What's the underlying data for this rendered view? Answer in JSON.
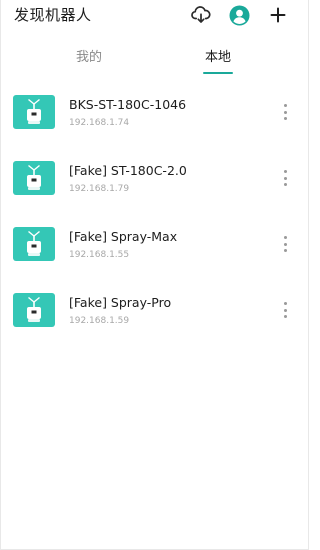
{
  "header": {
    "title": "发现机器人",
    "icons": [
      "cloud-download-icon",
      "user-avatar-icon",
      "add-icon"
    ]
  },
  "tabs": [
    {
      "label": "我的",
      "active": false
    },
    {
      "label": "本地",
      "active": true
    }
  ],
  "devices": [
    {
      "name": "BKS-ST-180C-1046",
      "ip": "192.168.1.74"
    },
    {
      "name": "[Fake] ST-180C-2.0",
      "ip": "192.168.1.79"
    },
    {
      "name": "[Fake] Spray-Max",
      "ip": "192.168.1.55"
    },
    {
      "name": "[Fake] Spray-Pro",
      "ip": "192.168.1.59"
    }
  ],
  "colors": {
    "accent": "#1aa99a",
    "thumb": "#34c7b6",
    "icon": "#2b2b2b"
  }
}
